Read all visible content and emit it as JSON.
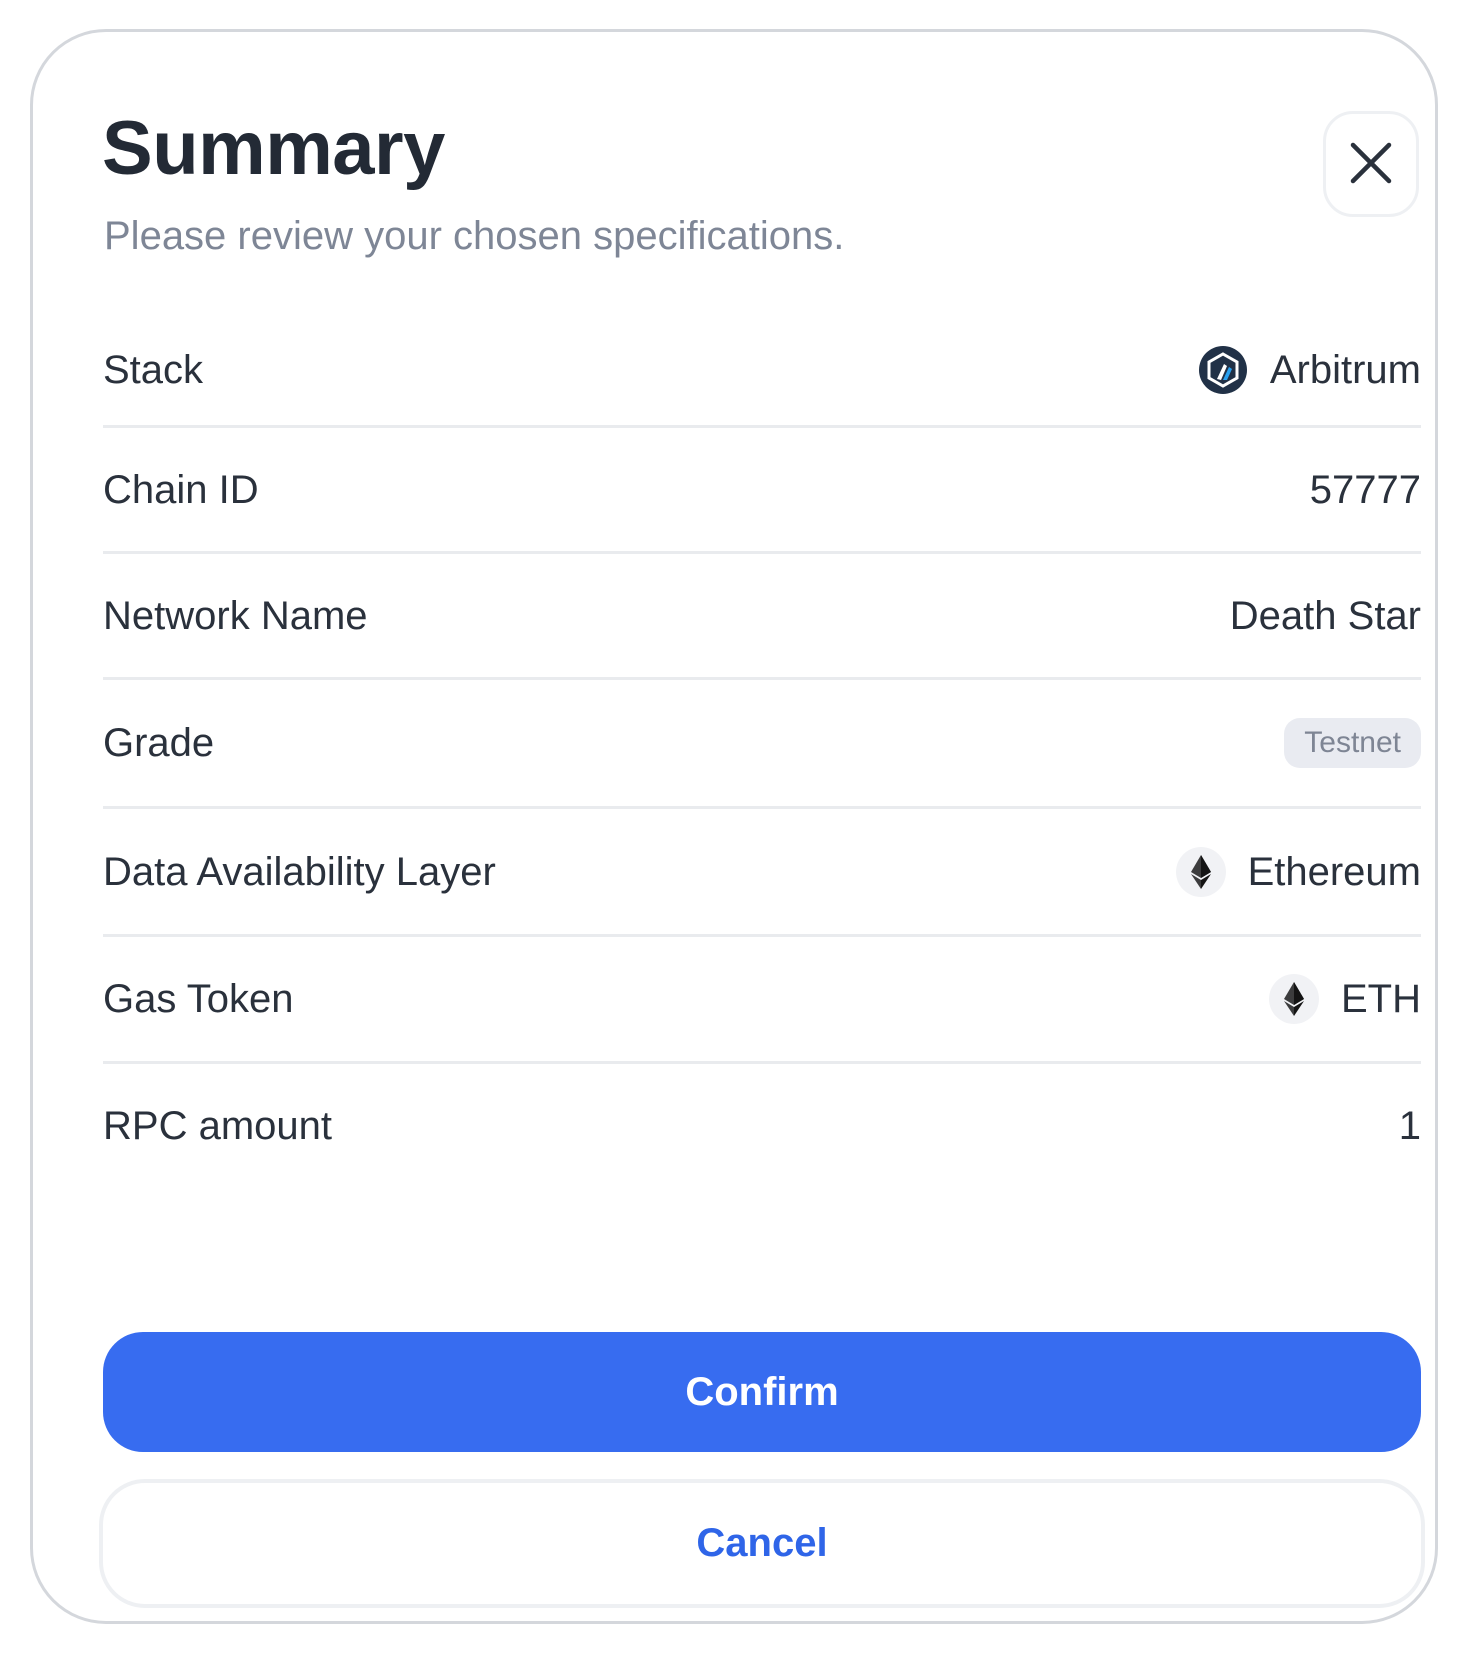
{
  "header": {
    "title": "Summary",
    "subtitle": "Please review your chosen specifications.",
    "close_icon": "close-icon"
  },
  "rows": [
    {
      "label": "Stack",
      "value": "Arbitrum",
      "icon": "arbitrum-logo-icon"
    },
    {
      "label": "Chain ID",
      "value": "57777"
    },
    {
      "label": "Network Name",
      "value": "Death Star"
    },
    {
      "label": "Grade",
      "value": "Testnet",
      "style": "badge"
    },
    {
      "label": "Data Availability Layer",
      "value": "Ethereum",
      "icon": "ethereum-icon"
    },
    {
      "label": "Gas Token",
      "value": "ETH",
      "icon": "ethereum-icon"
    },
    {
      "label": "RPC amount",
      "value": "1"
    }
  ],
  "actions": {
    "confirm_label": "Confirm",
    "cancel_label": "Cancel"
  },
  "colors": {
    "primary": "#376cf0",
    "title_text": "#232a35",
    "subtitle_text": "#7e8696",
    "badge_bg": "#e9ebf1",
    "arbitrum_navy": "#213147",
    "arbitrum_blue": "#28a0f0"
  }
}
